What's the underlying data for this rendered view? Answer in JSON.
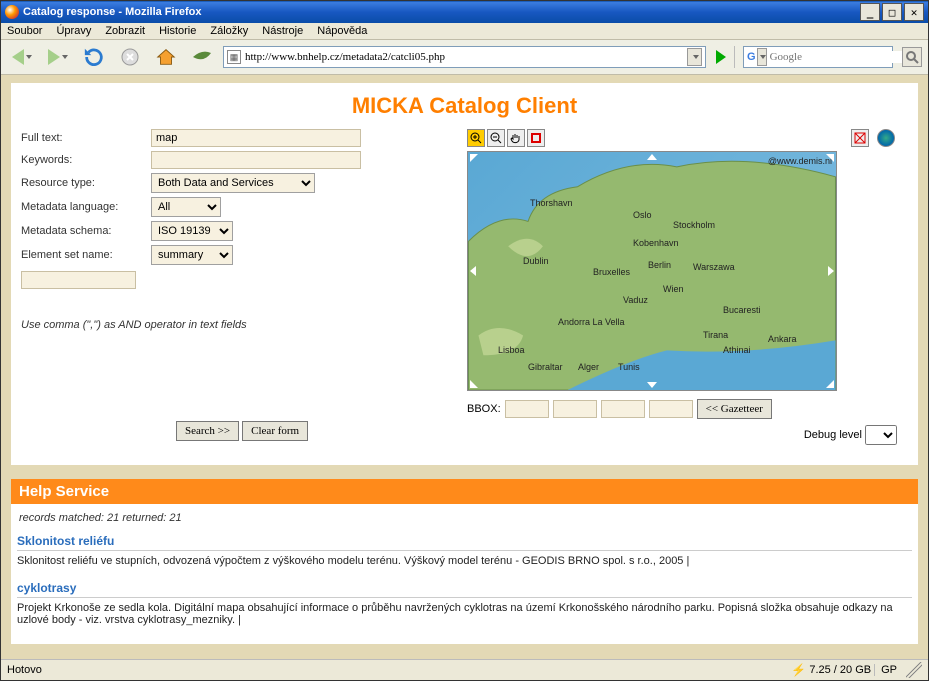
{
  "window": {
    "title": "Catalog response - Mozilla Firefox"
  },
  "menu": [
    "Soubor",
    "Úpravy",
    "Zobrazit",
    "Historie",
    "Záložky",
    "Nástroje",
    "Nápověda"
  ],
  "urlbar": {
    "value": "http://www.bnhelp.cz/metadata2/catcli05.php"
  },
  "searchbox": {
    "placeholder": "Google",
    "engine_letter": "G"
  },
  "page": {
    "title": "MICKA Catalog Client",
    "form": {
      "labels": {
        "fulltext": "Full text:",
        "keywords": "Keywords:",
        "resource_type": "Resource type:",
        "meta_lang": "Metadata language:",
        "meta_schema": "Metadata schema:",
        "elem_set": "Element set name:"
      },
      "values": {
        "fulltext": "map",
        "keywords": "",
        "resource_type": "Both Data and Services",
        "meta_lang": "All",
        "meta_schema": "ISO 19139",
        "elem_set": "summary"
      },
      "hint": "Use comma (\",\") as AND operator in text fields",
      "search_btn": "Search >>",
      "clear_btn": "Clear form"
    },
    "map": {
      "bbox_label": "BBOX:",
      "gazetteer_btn": "<< Gazetteer",
      "debug_label": "Debug level",
      "copyright": "@www.demis.nl",
      "cities": [
        "Thorshavn",
        "Oslo",
        "Stockholm",
        "Kobenhavn",
        "Dublin",
        "Berlin",
        "Warszawa",
        "Bruxelles",
        "Wien",
        "Vaduz",
        "Bucaresti",
        "Andorra La Vella",
        "Tirana",
        "Ankara",
        "Lisboa",
        "Athinai",
        "Gibraltar",
        "Alger",
        "Tunis"
      ]
    },
    "result_header": "Help Service",
    "records_status": "records matched: 21 returned: 21",
    "records": [
      {
        "title": "Sklonitost reliéfu",
        "desc": "Sklonitost reliéfu ve stupních, odvozená výpočtem z výškového modelu terénu. Výškový model terénu - GEODIS BRNO spol. s r.o., 2005 |"
      },
      {
        "title": "cyklotrasy",
        "desc": "Projekt Krkonoše ze sedla kola. Digitální mapa obsahující informace o průběhu navržených cyklotras na území Krkonošského národního parku. Popisná složka obsahuje odkazy na uzlové body - viz. vrstva cyklotrasy_mezniky. |"
      }
    ]
  },
  "status": {
    "text": "Hotovo",
    "quota": "7.25 / 20 GB",
    "gp": "GP"
  }
}
